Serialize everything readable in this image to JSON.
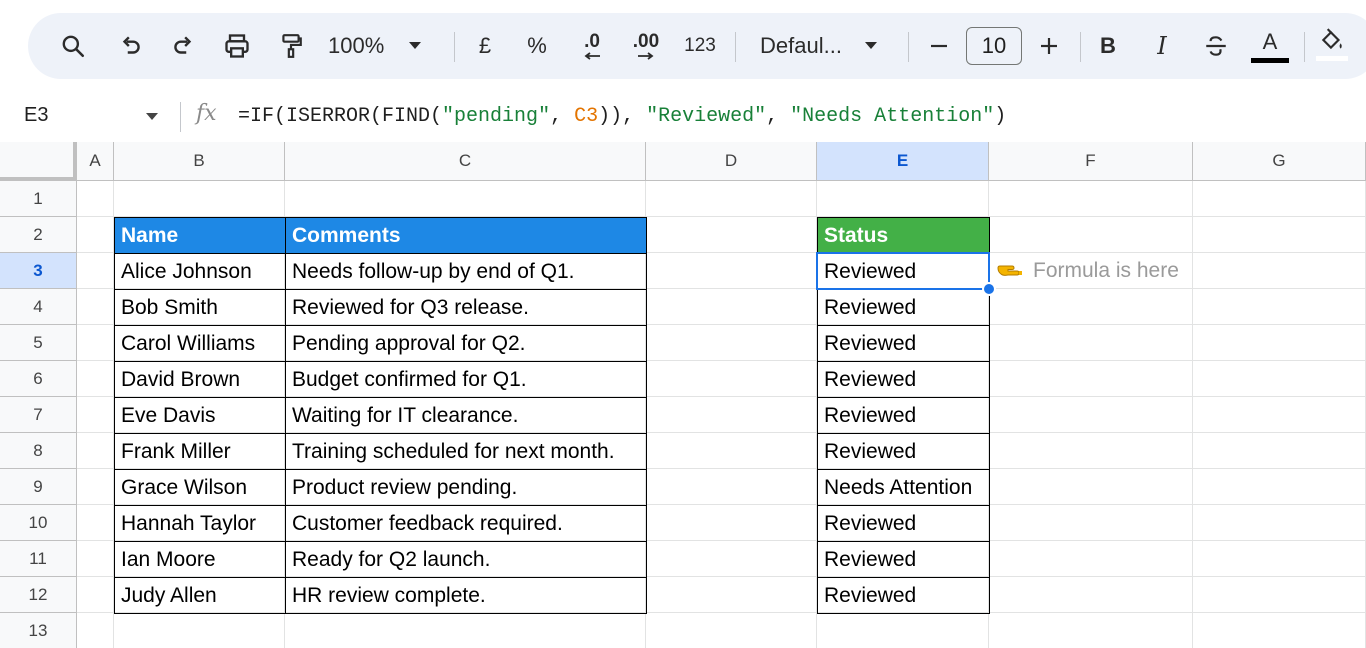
{
  "toolbar": {
    "zoom": "100%",
    "currency_label": "£",
    "percent_label": "%",
    "decrease_decimal_label": ".0",
    "increase_decimal_label": ".00",
    "more_formats_label": "123",
    "font_family": "Defaul...",
    "font_size": "10",
    "bold_label": "B",
    "italic_label": "I",
    "text_color_label": "A",
    "text_color": "#000000"
  },
  "formula_bar": {
    "cell_ref": "E3",
    "fx_label": "fx",
    "formula_parts": {
      "p1": "=IF(ISERROR(FIND(",
      "p2": "\"pending\"",
      "p3": ", ",
      "p4": "C3",
      "p5": ")), ",
      "p6": "\"Reviewed\"",
      "p7": ", ",
      "p8": "\"Needs Attention\"",
      "p9": ")"
    }
  },
  "grid": {
    "columns": [
      "A",
      "B",
      "C",
      "D",
      "E",
      "F",
      "G"
    ],
    "rows": [
      "1",
      "2",
      "3",
      "4",
      "5",
      "6",
      "7",
      "8",
      "9",
      "10",
      "11",
      "12",
      "13"
    ],
    "active_cell": "E3",
    "headers": {
      "name": "Name",
      "comments": "Comments",
      "status": "Status"
    },
    "records": [
      {
        "name": "Alice Johnson",
        "comment": "Needs follow-up by end of Q1.",
        "status": "Reviewed"
      },
      {
        "name": "Bob Smith",
        "comment": "Reviewed for Q3 release.",
        "status": "Reviewed"
      },
      {
        "name": "Carol Williams",
        "comment": "Pending approval for Q2.",
        "status": "Reviewed"
      },
      {
        "name": "David Brown",
        "comment": "Budget confirmed for Q1.",
        "status": "Reviewed"
      },
      {
        "name": "Eve Davis",
        "comment": "Waiting for IT clearance.",
        "status": "Reviewed"
      },
      {
        "name": "Frank Miller",
        "comment": "Training scheduled for next month.",
        "status": "Reviewed"
      },
      {
        "name": "Grace Wilson",
        "comment": "Product review pending.",
        "status": "Needs Attention"
      },
      {
        "name": "Hannah Taylor",
        "comment": "Customer feedback required.",
        "status": "Reviewed"
      },
      {
        "name": "Ian Moore",
        "comment": "Ready for Q2 launch.",
        "status": "Reviewed"
      },
      {
        "name": "Judy Allen",
        "comment": "HR review complete.",
        "status": "Reviewed"
      }
    ],
    "annotation": {
      "icon": "pointing-hand-icon",
      "text": "Formula is here"
    }
  },
  "colors": {
    "header_blue": "#1e88e5",
    "header_green": "#43b047",
    "selection": "#1a73e8"
  }
}
